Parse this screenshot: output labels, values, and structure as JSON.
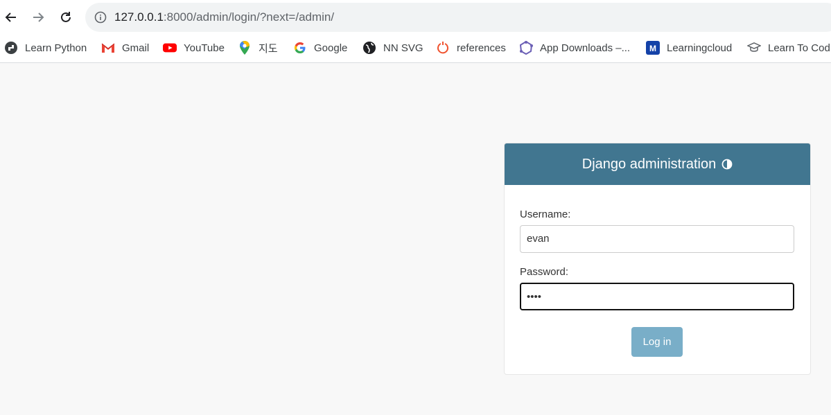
{
  "browser": {
    "url_host": "127.0.0.1",
    "url_rest": ":8000/admin/login/?next=/admin/",
    "bookmarks": [
      {
        "label": "Learn Python",
        "icon": "python-icon"
      },
      {
        "label": "Gmail",
        "icon": "gmail-icon"
      },
      {
        "label": "YouTube",
        "icon": "youtube-icon"
      },
      {
        "label": "지도",
        "icon": "maps-icon"
      },
      {
        "label": "Google",
        "icon": "google-icon"
      },
      {
        "label": "NN SVG",
        "icon": "globe-icon"
      },
      {
        "label": "references",
        "icon": "references-icon"
      },
      {
        "label": "App Downloads –...",
        "icon": "app-downloads-icon"
      },
      {
        "label": "Learningcloud",
        "icon": "learningcloud-icon"
      },
      {
        "label": "Learn To Cod",
        "icon": "graduation-cap-icon"
      }
    ]
  },
  "login": {
    "title": "Django administration",
    "username_label": "Username:",
    "username_value": "evan",
    "password_label": "Password:",
    "password_value": "••••",
    "submit_label": "Log in"
  },
  "colors": {
    "header_bg": "#417690",
    "button_bg": "#79aec8",
    "page_bg": "#f8f8f8"
  }
}
